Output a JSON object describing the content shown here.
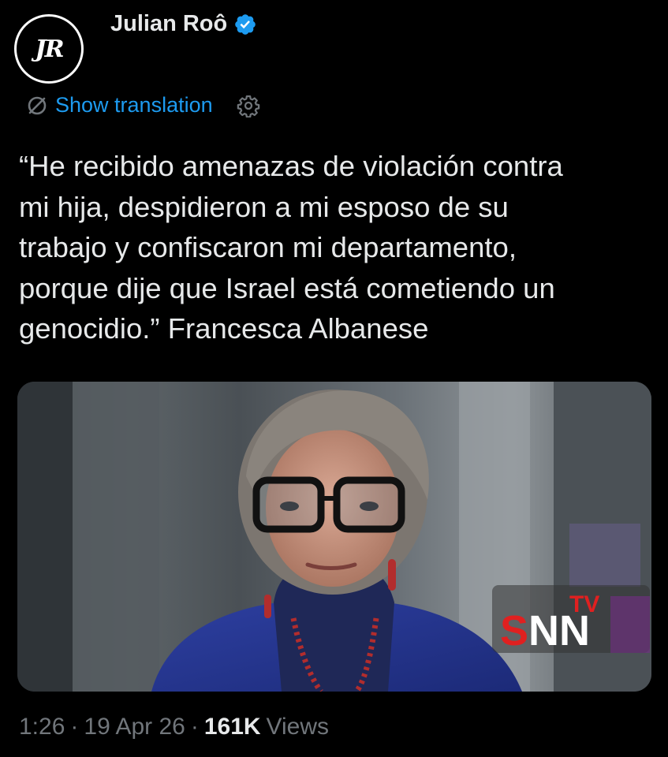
{
  "author": {
    "avatar_text": "JR",
    "name": "Julian Roô",
    "verified": true
  },
  "translation": {
    "label": "Show translation"
  },
  "tweet": {
    "text": "“He recibido amenazas de violación contra\nmi hija, despidieron a mi esposo de su\ntrabajo y confiscaron mi departamento,\nporque dije que Israel está cometiendo un\ngenocidio.” Francesca Albanese"
  },
  "media": {
    "watermark_brand": "SNN",
    "watermark_tv": "TV"
  },
  "meta": {
    "time": "1:26",
    "separator": "·",
    "date": "19 Apr 26",
    "views_count": "161K",
    "views_label": "Views"
  },
  "colors": {
    "background": "#000000",
    "link": "#1d9bf0",
    "text": "#e7e9ea",
    "muted": "#71767b",
    "verified": "#1d9bf0"
  }
}
